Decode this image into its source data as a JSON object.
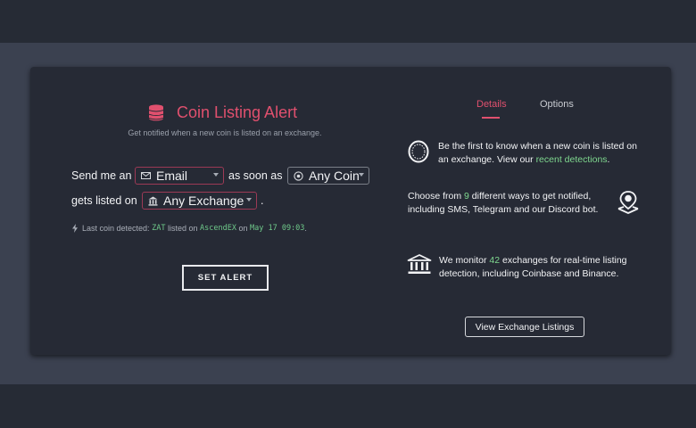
{
  "header": {
    "title": "Coin Listing Alert",
    "subtitle": "Get notified when a new coin is listed on an exchange."
  },
  "sentence": {
    "send_me_an": "Send me an",
    "as_soon_as": "as soon as",
    "gets_listed_on": "gets listed on",
    "period": "."
  },
  "selects": {
    "method": {
      "value": "Email",
      "icon": "envelope-icon"
    },
    "coin": {
      "value": "Any Coin",
      "icon": "coin-icon"
    },
    "exchange": {
      "value": "Any Exchange",
      "icon": "bank-icon"
    }
  },
  "last_detected": {
    "prefix": "Last coin detected:",
    "coin": "ZAT",
    "listed_on": "listed on",
    "exchange": "AscendEX",
    "on": "on",
    "datetime": "May 17 09:03",
    "suffix": "."
  },
  "set_alert_label": "SET ALERT",
  "tabs": [
    {
      "label": "Details",
      "active": true
    },
    {
      "label": "Options",
      "active": false
    }
  ],
  "features": [
    {
      "icon": "coin-icon",
      "text_before": "Be the first to know when a new coin is listed on an exchange. View our",
      "link": "recent detections",
      "text_after": "."
    },
    {
      "icon": "location-bell-icon",
      "text_before": "Choose from",
      "highlight": "9",
      "text_after": "different ways to get notified, including SMS, Telegram and our Discord bot."
    },
    {
      "icon": "bank-icon",
      "text_before": "We monitor",
      "highlight": "42",
      "text_after": "exchanges for real-time listing detection, including Coinbase and Binance."
    }
  ],
  "view_listings_label": "View Exchange Listings",
  "colors": {
    "accent": "#e0506e",
    "highlight": "#7fd88f",
    "card_bg": "#262a35",
    "band_bg": "#3b4150"
  }
}
